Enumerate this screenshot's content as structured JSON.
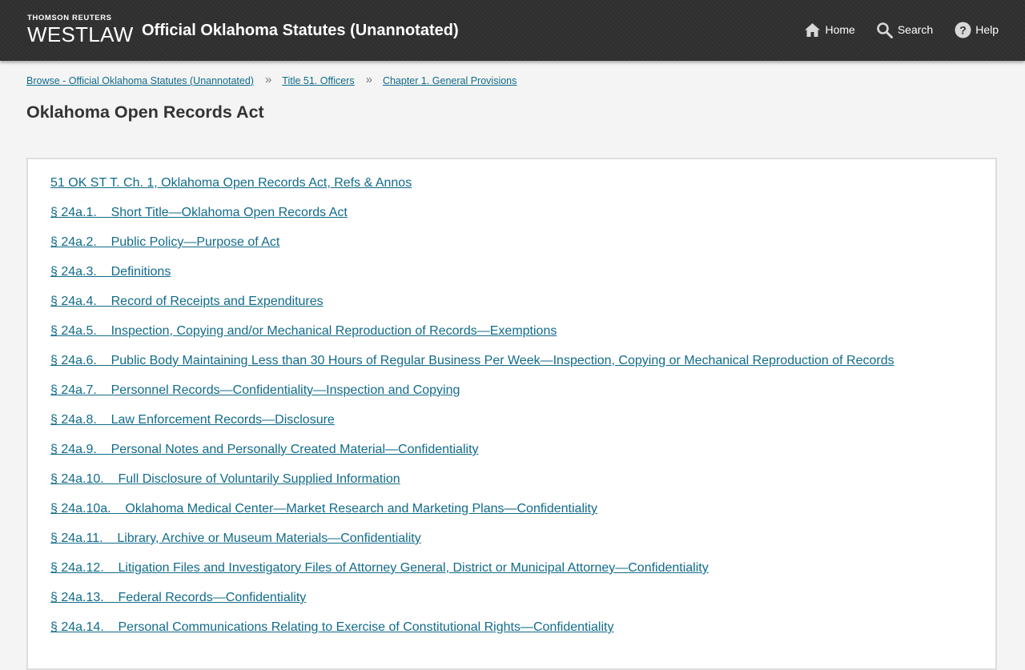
{
  "header": {
    "brand_top": "THOMSON REUTERS",
    "brand_main": "WESTLAW",
    "title": "Official Oklahoma Statutes (Unannotated)",
    "nav": {
      "home": "Home",
      "search": "Search",
      "help": "Help"
    }
  },
  "breadcrumb": [
    "Browse - Official Oklahoma Statutes (Unannotated)",
    "Title 51. Officers",
    "Chapter 1. General Provisions"
  ],
  "page_title": "Oklahoma Open Records Act",
  "toc": [
    "51 OK ST T. Ch. 1, Oklahoma Open Records Act, Refs & Annos",
    "§ 24a.1.    Short Title—Oklahoma Open Records Act",
    "§ 24a.2.    Public Policy—Purpose of Act",
    "§ 24a.3.    Definitions",
    "§ 24a.4.    Record of Receipts and Expenditures",
    "§ 24a.5.    Inspection, Copying and/or Mechanical Reproduction of Records—Exemptions",
    "§ 24a.6.    Public Body Maintaining Less than 30 Hours of Regular Business Per Week—Inspection, Copying or Mechanical Reproduction of Records",
    "§ 24a.7.    Personnel Records—Confidentiality—Inspection and Copying",
    "§ 24a.8.    Law Enforcement Records—Disclosure",
    "§ 24a.9.    Personal Notes and Personally Created Material—Confidentiality",
    "§ 24a.10.    Full Disclosure of Voluntarily Supplied Information",
    "§ 24a.10a.    Oklahoma Medical Center—Market Research and Marketing Plans—Confidentiality",
    "§ 24a.11.    Library, Archive or Museum Materials—Confidentiality",
    "§ 24a.12.    Litigation Files and Investigatory Files of Attorney General, District or Municipal Attorney—Confidentiality",
    "§ 24a.13.    Federal Records—Confidentiality",
    "§ 24a.14.    Personal Communications Relating to Exercise of Constitutional Rights—Confidentiality"
  ],
  "colors": {
    "header_bg": "#2f2f2f",
    "link": "#116b8a",
    "page_bg": "#f4f4f4"
  }
}
